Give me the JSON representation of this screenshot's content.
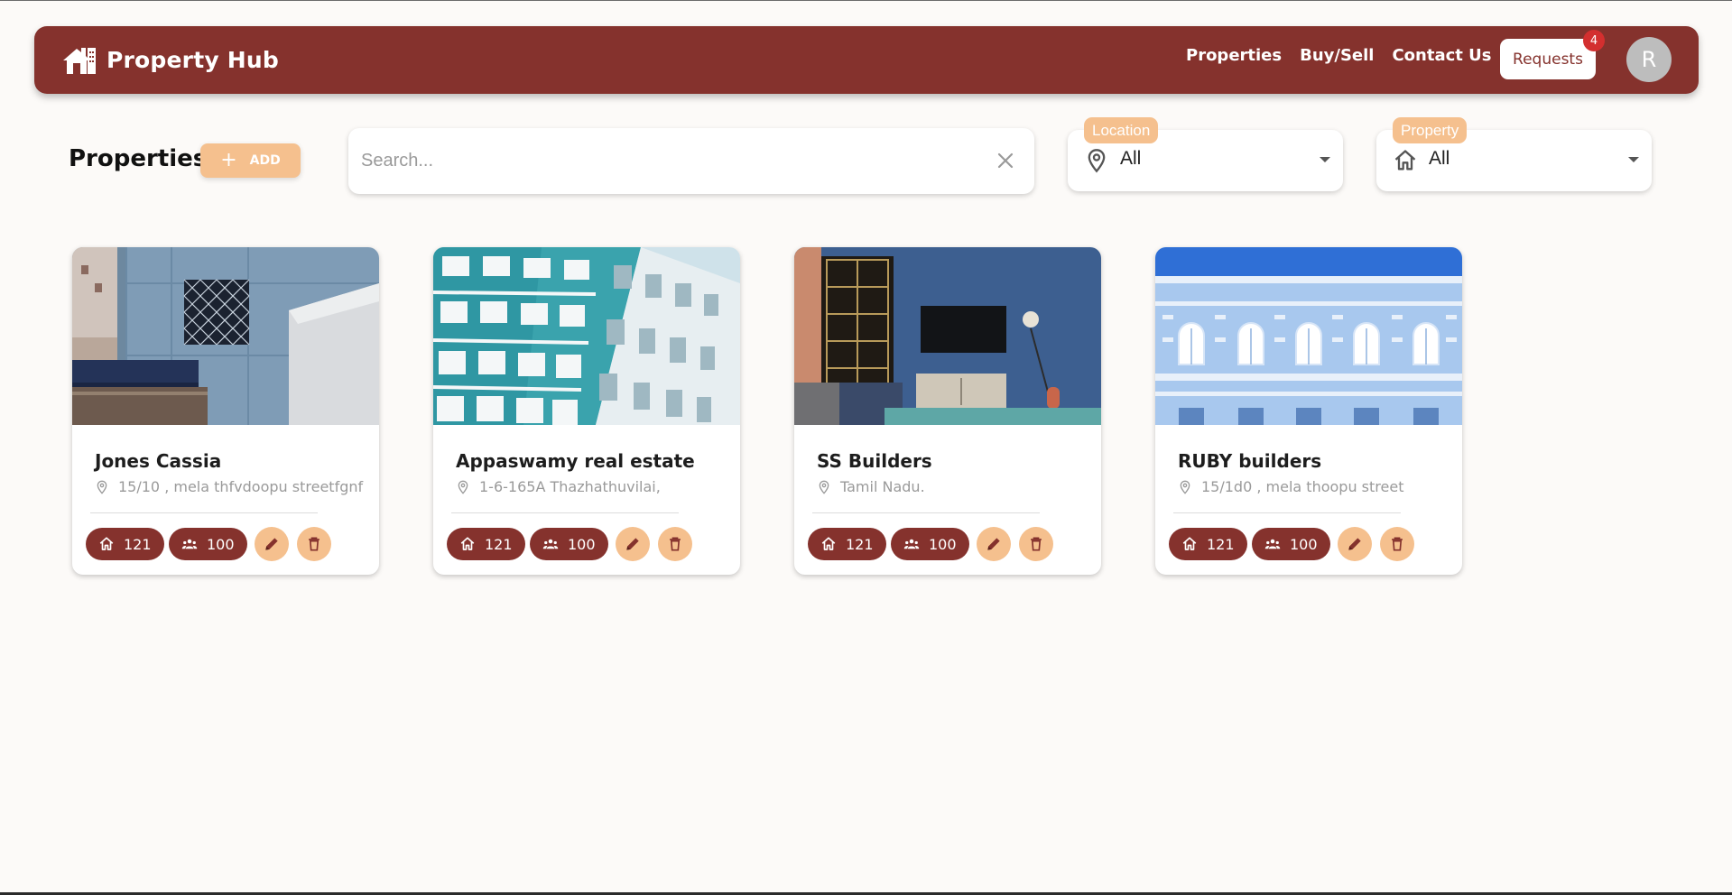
{
  "app": {
    "brand": "Property Hub"
  },
  "nav": {
    "links": [
      "Properties",
      "Buy/Sell",
      "Contact Us"
    ],
    "requests_label": "Requests",
    "requests_count": "4",
    "avatar_initial": "R"
  },
  "toolbar": {
    "title": "Properties",
    "add_label": "ADD",
    "search_placeholder": "Search...",
    "location_label": "Location",
    "location_value": "All",
    "property_label": "Property",
    "property_value": "All"
  },
  "cards": [
    {
      "title": "Jones Cassia",
      "address": "15/10 , mela thfvdoopu streetfgnf",
      "units": "121",
      "people": "100"
    },
    {
      "title": "Appaswamy real estate",
      "address": "1-6-165A Thazhathuvilai,",
      "units": "121",
      "people": "100"
    },
    {
      "title": "SS Builders",
      "address": "Tamil Nadu.",
      "units": "121",
      "people": "100"
    },
    {
      "title": "RUBY builders",
      "address": "15/1d0 , mela thoopu street",
      "units": "121",
      "people": "100"
    }
  ],
  "colors": {
    "primary": "#85322d",
    "accent": "#f5c08e",
    "background": "#fcfaf8",
    "badge": "#d32f2f"
  }
}
